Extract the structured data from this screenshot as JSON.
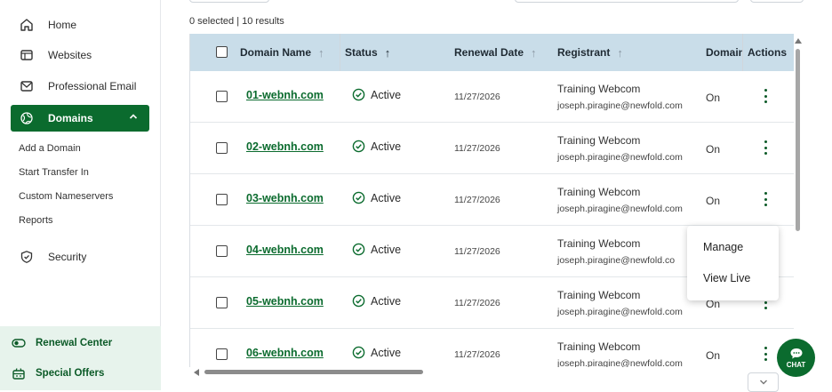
{
  "sidebar": {
    "nav": [
      {
        "label": "Home",
        "icon": "home-icon"
      },
      {
        "label": "Websites",
        "icon": "browser-window-icon"
      },
      {
        "label": "Professional Email",
        "icon": "mail-icon"
      },
      {
        "label": "Domains",
        "icon": "globe-icon",
        "active": true
      },
      {
        "label": "Security",
        "icon": "shield-icon"
      }
    ],
    "domain_sub": [
      "Add a Domain",
      "Start Transfer In",
      "Custom Nameservers",
      "Reports"
    ],
    "bottom": [
      {
        "label": "Renewal Center",
        "icon": "toggle-icon"
      },
      {
        "label": "Special Offers",
        "icon": "gift-icon"
      }
    ]
  },
  "results_text": "0 selected | 10 results",
  "table": {
    "headers": {
      "domain": "Domain Name",
      "status": "Status",
      "renewal": "Renewal Date",
      "registrant": "Registrant",
      "autorenew": "Domain",
      "actions": "Actions"
    },
    "rows": [
      {
        "domain": "01-webnh.com",
        "status": "Active",
        "renewal": "11/27/2026",
        "reg_name": "Training Webcom",
        "reg_email": "joseph.piragine@newfold.com",
        "auto": "On"
      },
      {
        "domain": "02-webnh.com",
        "status": "Active",
        "renewal": "11/27/2026",
        "reg_name": "Training Webcom",
        "reg_email": "joseph.piragine@newfold.com",
        "auto": "On"
      },
      {
        "domain": "03-webnh.com",
        "status": "Active",
        "renewal": "11/27/2026",
        "reg_name": "Training Webcom",
        "reg_email": "joseph.piragine@newfold.com",
        "auto": "On"
      },
      {
        "domain": "04-webnh.com",
        "status": "Active",
        "renewal": "11/27/2026",
        "reg_name": "Training Webcom",
        "reg_email": "joseph.piragine@newfold.co",
        "auto": ""
      },
      {
        "domain": "05-webnh.com",
        "status": "Active",
        "renewal": "11/27/2026",
        "reg_name": "Training Webcom",
        "reg_email": "joseph.piragine@newfold.com",
        "auto": "On"
      },
      {
        "domain": "06-webnh.com",
        "status": "Active",
        "renewal": "11/27/2026",
        "reg_name": "Training Webcom",
        "reg_email": "joseph.piragine@newfold.com",
        "auto": "On"
      }
    ]
  },
  "action_menu": {
    "manage": "Manage",
    "view_live": "View Live"
  },
  "chat_label": "CHAT",
  "colors": {
    "brand_green": "#0b6b2e",
    "header_blue": "#c9dde9",
    "sidebar_bottom": "#e7f3ec"
  }
}
